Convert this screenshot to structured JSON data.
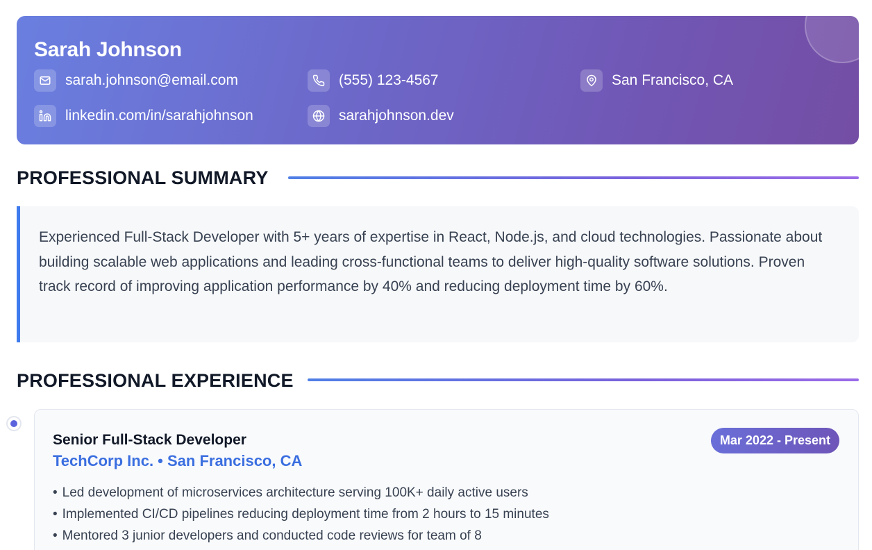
{
  "header": {
    "name": "Sarah Johnson",
    "contacts": [
      {
        "icon": "mail-icon",
        "text": "sarah.johnson@email.com"
      },
      {
        "icon": "phone-icon",
        "text": "(555) 123-4567"
      },
      {
        "icon": "location-pin-icon",
        "text": "San Francisco, CA"
      },
      {
        "icon": "linkedin-icon",
        "text": "linkedin.com/in/sarahjohnson"
      },
      {
        "icon": "globe-icon",
        "text": "sarahjohnson.dev"
      }
    ]
  },
  "summary": {
    "heading": "PROFESSIONAL SUMMARY",
    "text": "Experienced Full-Stack Developer with 5+ years of expertise in React, Node.js, and cloud technologies. Passionate about building scalable web applications and leading cross-functional teams to deliver high-quality software solutions. Proven track record of improving application performance by 40% and reducing deployment time by 60%."
  },
  "experience": {
    "heading": "PROFESSIONAL EXPERIENCE",
    "jobs": [
      {
        "title": "Senior Full-Stack Developer",
        "company_location": "TechCorp Inc. • San Francisco, CA",
        "dates": "Mar 2022 - Present",
        "bullets": [
          "Led development of microservices architecture serving 100K+ daily active users",
          "Implemented CI/CD pipelines reducing deployment time from 2 hours to 15 minutes",
          "Mentored 3 junior developers and conducted code reviews for team of 8"
        ]
      }
    ]
  },
  "colors": {
    "header_gradient_start": "#6a7fe0",
    "header_gradient_end": "#744ea4",
    "accent_blue": "#3b6fe0",
    "summary_border": "#3f7bee",
    "timeline_dot": "#5b63dd"
  }
}
